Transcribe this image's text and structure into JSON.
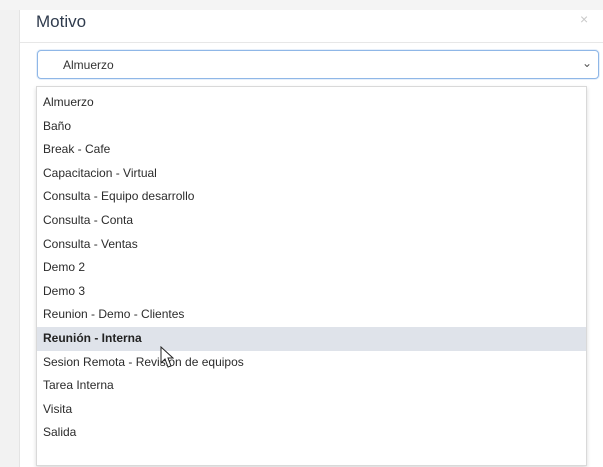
{
  "modal": {
    "title": "Motivo",
    "close_label": "×"
  },
  "select": {
    "value": "Almuerzo",
    "caret_icon": "chevron-down-icon"
  },
  "dropdown": {
    "items": [
      "Almuerzo",
      "Baño",
      "Break - Cafe",
      "Capacitacion - Virtual",
      "Consulta - Equipo desarrollo",
      "Consulta - Conta",
      "Consulta - Ventas",
      "Demo 2",
      "Demo 3",
      "Reunion - Demo - Clientes",
      "Reunión - Interna",
      "Sesion Remota - Revision de equipos",
      "Tarea Interna",
      "Visita",
      "Salida"
    ],
    "selected_index": 10
  },
  "colors": {
    "highlight": "#dfe3ea",
    "select_border": "#8fb7e7",
    "nav_blue": "#1f3c63"
  }
}
